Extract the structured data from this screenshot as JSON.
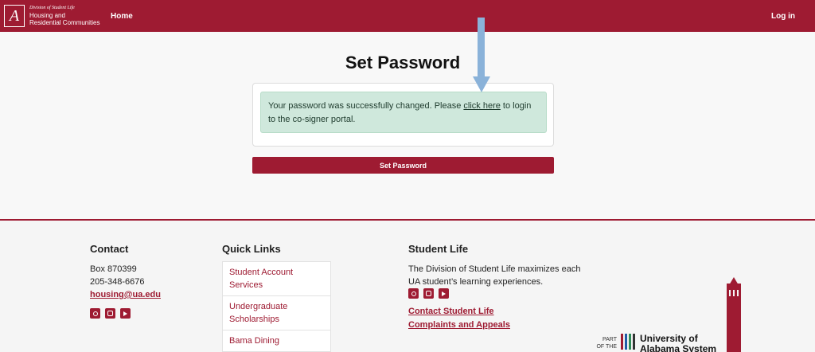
{
  "header": {
    "logo_letter": "A",
    "division": "Division of Student Life",
    "unit_line1": "Housing and",
    "unit_line2": "Residential Communities",
    "nav_home": "Home",
    "nav_login": "Log in"
  },
  "main": {
    "title": "Set Password",
    "alert_pre": "Your password was successfully changed. Please ",
    "alert_link": "click here",
    "alert_post": " to login to the co-signer portal.",
    "button_label": "Set Password"
  },
  "footer": {
    "contact": {
      "heading": "Contact",
      "box": "Box 870399",
      "phone": "205-348-6676",
      "email": "housing@ua.edu"
    },
    "quick_links": {
      "heading": "Quick Links",
      "items": [
        {
          "label": "Student Account Services"
        },
        {
          "label": "Undergraduate Scholarships"
        },
        {
          "label": "Bama Dining"
        }
      ]
    },
    "student_life": {
      "heading": "Student Life",
      "description": "The Division of Student Life maximizes each UA student’s learning experiences.",
      "link1": "Contact Student Life",
      "link2": "Complaints and Appeals"
    },
    "system": {
      "part_of": "PART OF THE",
      "name_line1": "University of",
      "name_line2": "Alabama System"
    },
    "social_icons": [
      "facebook-icon",
      "instagram-icon",
      "youtube-icon"
    ]
  },
  "colors": {
    "brand": "#9e1b32",
    "alert_bg": "#cfe8dc",
    "arrow": "#8ab2d9"
  }
}
